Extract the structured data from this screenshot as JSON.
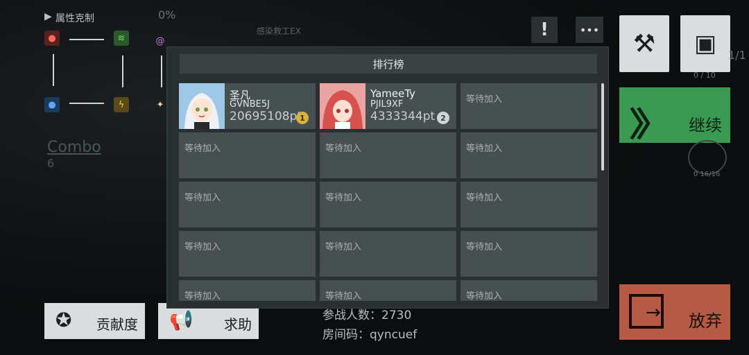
{
  "hud": {
    "attribute_title": "属性克制",
    "percent": "0%",
    "room_label": "感染救工EX",
    "combo_label": "Combo",
    "combo_value": "6",
    "counter_right": "1/1",
    "counter_small": "0 / 10",
    "circle_count": "0 16/16"
  },
  "leaderboard": {
    "title": "排行榜",
    "players": [
      {
        "name": "圣凡",
        "id": "GVNBE5J",
        "points": "20695108pt",
        "rank": "1",
        "medal_color": "#d8b23a"
      },
      {
        "name": "YameeTy",
        "id": "PJIL9XF",
        "points": "4333344pt",
        "rank": "2",
        "medal_color": "#cfd4d5"
      }
    ],
    "waiting_label": "等待加入"
  },
  "buttons": {
    "continue": "继续",
    "give_up": "放弃",
    "contribution": "贡献度",
    "help": "求助"
  },
  "room_info": {
    "participants": "参战人数：2730",
    "room_code": "房间码：qyncuef"
  },
  "colors": {
    "continue_green": "#3b9a52",
    "giveup_red": "#b45a45",
    "panel": "#2a2f31",
    "cell": "#475051"
  }
}
